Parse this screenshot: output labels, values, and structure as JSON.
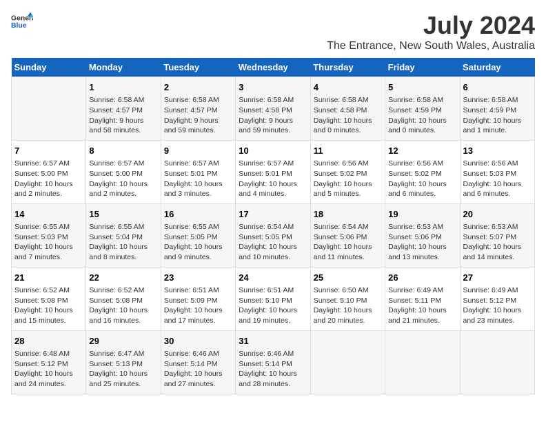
{
  "logo": {
    "general": "General",
    "blue": "Blue"
  },
  "title": "July 2024",
  "subtitle": "The Entrance, New South Wales, Australia",
  "days_header": [
    "Sunday",
    "Monday",
    "Tuesday",
    "Wednesday",
    "Thursday",
    "Friday",
    "Saturday"
  ],
  "weeks": [
    [
      {
        "day": "",
        "info": ""
      },
      {
        "day": "1",
        "info": "Sunrise: 6:58 AM\nSunset: 4:57 PM\nDaylight: 9 hours\nand 58 minutes."
      },
      {
        "day": "2",
        "info": "Sunrise: 6:58 AM\nSunset: 4:57 PM\nDaylight: 9 hours\nand 59 minutes."
      },
      {
        "day": "3",
        "info": "Sunrise: 6:58 AM\nSunset: 4:58 PM\nDaylight: 9 hours\nand 59 minutes."
      },
      {
        "day": "4",
        "info": "Sunrise: 6:58 AM\nSunset: 4:58 PM\nDaylight: 10 hours\nand 0 minutes."
      },
      {
        "day": "5",
        "info": "Sunrise: 6:58 AM\nSunset: 4:59 PM\nDaylight: 10 hours\nand 0 minutes."
      },
      {
        "day": "6",
        "info": "Sunrise: 6:58 AM\nSunset: 4:59 PM\nDaylight: 10 hours\nand 1 minute."
      }
    ],
    [
      {
        "day": "7",
        "info": "Sunrise: 6:57 AM\nSunset: 5:00 PM\nDaylight: 10 hours\nand 2 minutes."
      },
      {
        "day": "8",
        "info": "Sunrise: 6:57 AM\nSunset: 5:00 PM\nDaylight: 10 hours\nand 2 minutes."
      },
      {
        "day": "9",
        "info": "Sunrise: 6:57 AM\nSunset: 5:01 PM\nDaylight: 10 hours\nand 3 minutes."
      },
      {
        "day": "10",
        "info": "Sunrise: 6:57 AM\nSunset: 5:01 PM\nDaylight: 10 hours\nand 4 minutes."
      },
      {
        "day": "11",
        "info": "Sunrise: 6:56 AM\nSunset: 5:02 PM\nDaylight: 10 hours\nand 5 minutes."
      },
      {
        "day": "12",
        "info": "Sunrise: 6:56 AM\nSunset: 5:02 PM\nDaylight: 10 hours\nand 6 minutes."
      },
      {
        "day": "13",
        "info": "Sunrise: 6:56 AM\nSunset: 5:03 PM\nDaylight: 10 hours\nand 6 minutes."
      }
    ],
    [
      {
        "day": "14",
        "info": "Sunrise: 6:55 AM\nSunset: 5:03 PM\nDaylight: 10 hours\nand 7 minutes."
      },
      {
        "day": "15",
        "info": "Sunrise: 6:55 AM\nSunset: 5:04 PM\nDaylight: 10 hours\nand 8 minutes."
      },
      {
        "day": "16",
        "info": "Sunrise: 6:55 AM\nSunset: 5:05 PM\nDaylight: 10 hours\nand 9 minutes."
      },
      {
        "day": "17",
        "info": "Sunrise: 6:54 AM\nSunset: 5:05 PM\nDaylight: 10 hours\nand 10 minutes."
      },
      {
        "day": "18",
        "info": "Sunrise: 6:54 AM\nSunset: 5:06 PM\nDaylight: 10 hours\nand 11 minutes."
      },
      {
        "day": "19",
        "info": "Sunrise: 6:53 AM\nSunset: 5:06 PM\nDaylight: 10 hours\nand 13 minutes."
      },
      {
        "day": "20",
        "info": "Sunrise: 6:53 AM\nSunset: 5:07 PM\nDaylight: 10 hours\nand 14 minutes."
      }
    ],
    [
      {
        "day": "21",
        "info": "Sunrise: 6:52 AM\nSunset: 5:08 PM\nDaylight: 10 hours\nand 15 minutes."
      },
      {
        "day": "22",
        "info": "Sunrise: 6:52 AM\nSunset: 5:08 PM\nDaylight: 10 hours\nand 16 minutes."
      },
      {
        "day": "23",
        "info": "Sunrise: 6:51 AM\nSunset: 5:09 PM\nDaylight: 10 hours\nand 17 minutes."
      },
      {
        "day": "24",
        "info": "Sunrise: 6:51 AM\nSunset: 5:10 PM\nDaylight: 10 hours\nand 19 minutes."
      },
      {
        "day": "25",
        "info": "Sunrise: 6:50 AM\nSunset: 5:10 PM\nDaylight: 10 hours\nand 20 minutes."
      },
      {
        "day": "26",
        "info": "Sunrise: 6:49 AM\nSunset: 5:11 PM\nDaylight: 10 hours\nand 21 minutes."
      },
      {
        "day": "27",
        "info": "Sunrise: 6:49 AM\nSunset: 5:12 PM\nDaylight: 10 hours\nand 23 minutes."
      }
    ],
    [
      {
        "day": "28",
        "info": "Sunrise: 6:48 AM\nSunset: 5:12 PM\nDaylight: 10 hours\nand 24 minutes."
      },
      {
        "day": "29",
        "info": "Sunrise: 6:47 AM\nSunset: 5:13 PM\nDaylight: 10 hours\nand 25 minutes."
      },
      {
        "day": "30",
        "info": "Sunrise: 6:46 AM\nSunset: 5:14 PM\nDaylight: 10 hours\nand 27 minutes."
      },
      {
        "day": "31",
        "info": "Sunrise: 6:46 AM\nSunset: 5:14 PM\nDaylight: 10 hours\nand 28 minutes."
      },
      {
        "day": "",
        "info": ""
      },
      {
        "day": "",
        "info": ""
      },
      {
        "day": "",
        "info": ""
      }
    ]
  ]
}
